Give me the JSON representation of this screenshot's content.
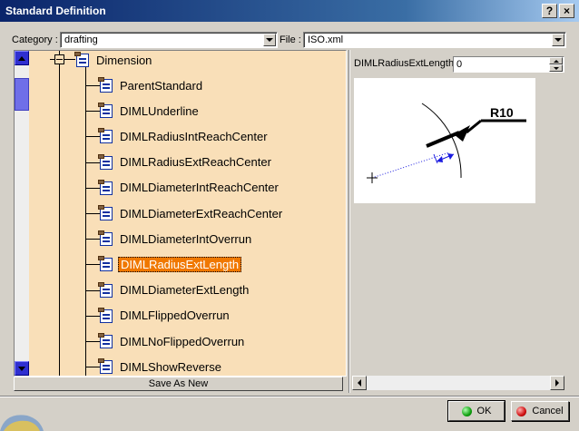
{
  "window": {
    "title": "Standard Definition",
    "help_glyph": "?",
    "close_glyph": "×"
  },
  "category": {
    "label": "Category :",
    "value": "drafting"
  },
  "file": {
    "label": "File :",
    "value": "ISO.xml"
  },
  "tree": {
    "root": "Dimension",
    "items": [
      "ParentStandard",
      "DIMLUnderline",
      "DIMLRadiusIntReachCenter",
      "DIMLRadiusExtReachCenter",
      "DIMLDiameterIntReachCenter",
      "DIMLDiameterExtReachCenter",
      "DIMLDiameterIntOverrun",
      "DIMLRadiusExtLength",
      "DIMLDiameterExtLength",
      "DIMLFlippedOverrun",
      "DIMLNoFlippedOverrun",
      "DIMLShowReverse"
    ],
    "selected_index": 7
  },
  "save_as_new_label": "Save As New",
  "parameter": {
    "label": "DIMLRadiusExtLength",
    "value": "0"
  },
  "preview": {
    "dimension_text": "R10"
  },
  "buttons": {
    "ok_label": "OK",
    "cancel_label": "Cancel"
  },
  "colors": {
    "selection": "#f07800",
    "panel": "#f9dfb8",
    "title_start": "#0a246a",
    "title_end": "#a6caf0"
  }
}
